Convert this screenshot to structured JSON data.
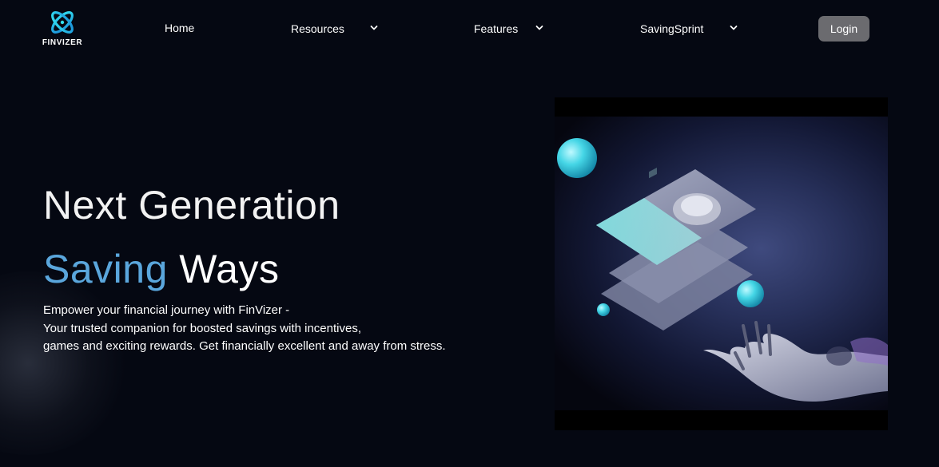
{
  "brand": {
    "name": "FINVIZER",
    "accent_color": "#5aa6dc",
    "logo_color": "#1ec8e6"
  },
  "nav": {
    "items": [
      {
        "label": "Home"
      },
      {
        "label": "Resources"
      },
      {
        "label": "Features"
      },
      {
        "label": "SavingSprint"
      }
    ],
    "login_label": "Login"
  },
  "hero": {
    "title_line1": "Next Generation",
    "title_line2_accent": "Saving",
    "title_line2_rest": "Ways",
    "description": [
      "Empower your financial journey with FinVizer -",
      "Your trusted companion for boosted savings with incentives,",
      "games and exciting rewards. Get financially excellent and away from stress."
    ]
  },
  "icons": {
    "logo": "finvizer-logo-icon",
    "dropdown": "chevron-down-icon"
  }
}
